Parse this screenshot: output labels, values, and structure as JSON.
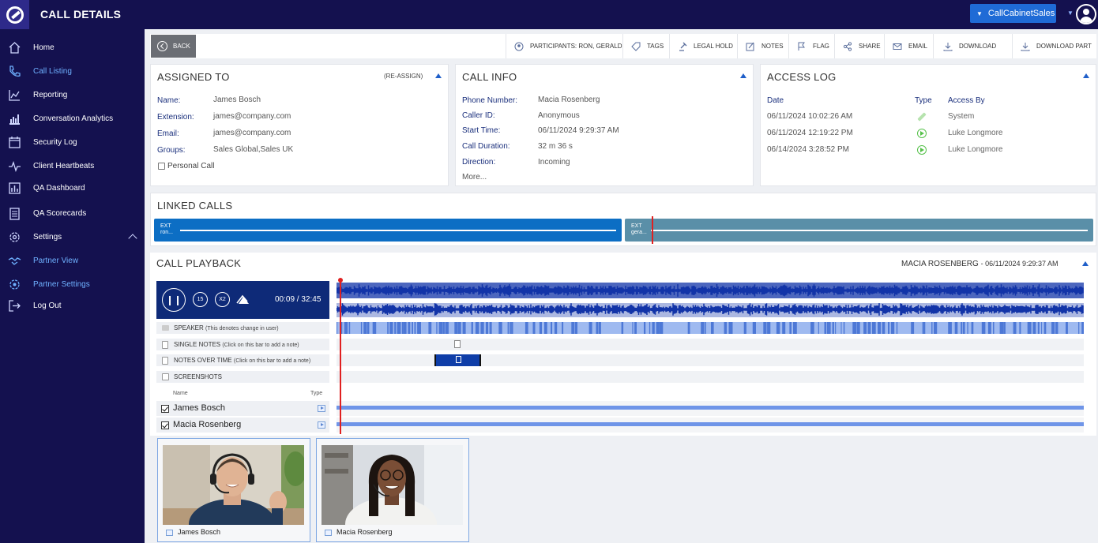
{
  "app": {
    "title": "CALL DETAILS",
    "account": "CallCabinetSales"
  },
  "sidebar": {
    "items": [
      {
        "label": "Home",
        "icon": "home-icon"
      },
      {
        "label": "Call Listing",
        "icon": "phone-icon",
        "active": true
      },
      {
        "label": "Reporting",
        "icon": "line-chart-icon"
      },
      {
        "label": "Conversation Analytics",
        "icon": "bar-chart-icon"
      },
      {
        "label": "Security Log",
        "icon": "calendar-icon"
      },
      {
        "label": "Client Heartbeats",
        "icon": "pulse-icon"
      },
      {
        "label": "QA Dashboard",
        "icon": "dashboard-icon"
      },
      {
        "label": "QA Scorecards",
        "icon": "clipboard-icon"
      },
      {
        "label": "Settings",
        "icon": "gear-icon"
      },
      {
        "label": "Partner View",
        "icon": "handshake-icon"
      },
      {
        "label": "Partner Settings",
        "icon": "partner-gear-icon"
      },
      {
        "label": "Log Out",
        "icon": "logout-icon"
      }
    ]
  },
  "toolbar": {
    "back": "BACK",
    "participants": "PARTICIPANTS: RON, GERALD",
    "tags": "TAGS",
    "legal_hold": "LEGAL HOLD",
    "notes": "NOTES",
    "flag": "FLAG",
    "share": "SHARE",
    "email": "EMAIL",
    "download": "DOWNLOAD",
    "download_part": "DOWNLOAD PART"
  },
  "assigned": {
    "title": "ASSIGNED TO",
    "reassign": "(RE-ASSIGN)",
    "name_label": "Name:",
    "name": "James Bosch",
    "extension_label": "Extension:",
    "extension": "james@company.com",
    "email_label": "Email:",
    "email": "james@company.com",
    "groups_label": "Groups:",
    "groups": "Sales Global,Sales UK",
    "personal_call": "Personal Call"
  },
  "call_info": {
    "title": "CALL INFO",
    "phone_label": "Phone Number:",
    "phone": "Macia Rosenberg",
    "caller_label": "Caller ID:",
    "caller": "Anonymous",
    "start_label": "Start Time:",
    "start": "06/11/2024 9:29:37 AM",
    "duration_label": "Call Duration:",
    "duration": "32 m 36 s",
    "direction_label": "Direction:",
    "direction": "Incoming",
    "more": "More..."
  },
  "access_log": {
    "title": "ACCESS LOG",
    "headers": {
      "date": "Date",
      "type": "Type",
      "by": "Access By"
    },
    "rows": [
      {
        "date": "06/11/2024 10:02:26 AM",
        "type": "edit",
        "by": "System"
      },
      {
        "date": "06/11/2024 12:19:22 PM",
        "type": "play",
        "by": "Luke Longmore"
      },
      {
        "date": "06/14/2024 3:28:52 PM",
        "type": "play",
        "by": "Luke Longmore"
      }
    ]
  },
  "linked": {
    "title": "LINKED CALLS",
    "calls": [
      {
        "ext": "EXT",
        "name": "ron..."
      },
      {
        "ext": "EXT",
        "name": "gera..."
      }
    ]
  },
  "playback": {
    "title": "CALL PLAYBACK",
    "caller": "MACIA ROSENBERG",
    "datetime": "- 06/11/2024 9:29:37 AM",
    "time": "00:09 / 32:45",
    "speed": "X2",
    "skip": "15",
    "tracks": {
      "speaker": "SPEAKER",
      "speaker_hint": "(This denotes change in user)",
      "single_notes": "SINGLE NOTES",
      "single_hint": "(Click on this bar to add a note)",
      "notes_over_time": "NOTES OVER TIME",
      "notes_hint": "(Click on this bar to add a note)",
      "screenshots": "SCREENSHOTS"
    },
    "participant_headers": {
      "name": "Name",
      "type": "Type"
    },
    "participants": [
      {
        "name": "James Bosch"
      },
      {
        "name": "Macia Rosenberg"
      }
    ]
  },
  "videos": [
    {
      "name": "James Bosch"
    },
    {
      "name": "Macia Rosenberg"
    }
  ],
  "colors": {
    "navy": "#14114f",
    "accent": "#1f6bd6",
    "link_blue": "#6fb1ff",
    "wave": "#1234a8"
  }
}
